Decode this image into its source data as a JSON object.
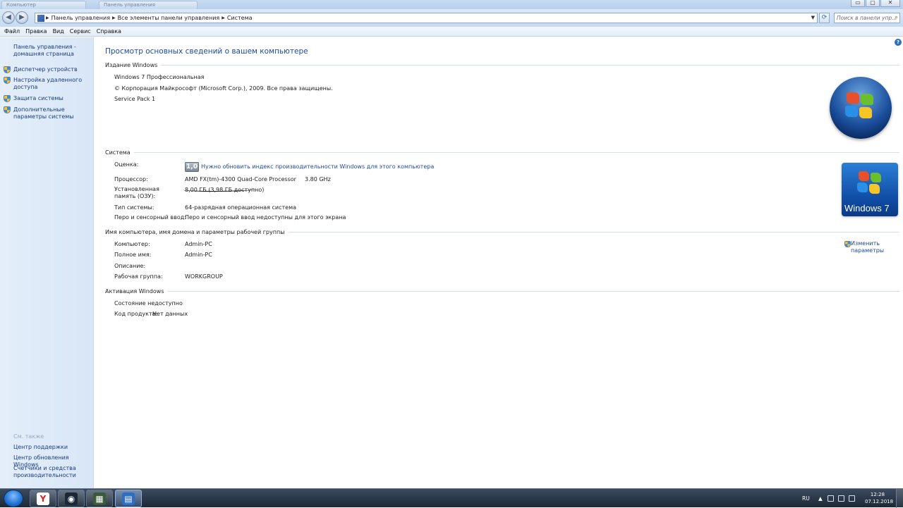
{
  "titlebar": {
    "ghost_tabs": [
      "Компьютер",
      "Панель управления"
    ]
  },
  "window_controls": {
    "minimize": "▭",
    "maximize": "▢",
    "close": "✕"
  },
  "navigation": {
    "back_glyph": "◀",
    "forward_glyph": "▶",
    "breadcrumb": [
      "Панель управления",
      "Все элементы панели управления",
      "Система"
    ],
    "refresh_glyph": "⟳",
    "search_placeholder": "Поиск в панели упр..."
  },
  "menu": [
    "Файл",
    "Правка",
    "Вид",
    "Сервис",
    "Справка"
  ],
  "sidebar": {
    "home_link": "Панель управления - домашняя страница",
    "tasks": [
      "Диспетчер устройств",
      "Настройка удаленного доступа",
      "Защита системы",
      "Дополнительные параметры системы"
    ],
    "see_also_header": "См. также",
    "see_also": [
      "Центр поддержки",
      "Центр обновления Windows",
      "Счетчики и средства производительности"
    ]
  },
  "main": {
    "title": "Просмотр основных сведений о вашем компьютере",
    "edition": {
      "header": "Издание Windows",
      "name": "Windows 7 Профессиональная",
      "copyright": "© Корпорация Майкрософт (Microsoft Corp.), 2009. Все права защищены.",
      "service_pack": "Service Pack 1"
    },
    "system": {
      "header": "Система",
      "rating_label": "Оценка:",
      "rating_badge": "1,0",
      "rating_link": "Нужно обновить индекс производительности Windows для этого компьютера",
      "cpu_label": "Процессор:",
      "cpu_value": "AMD FX(tm)-4300 Quad-Core Processor",
      "cpu_speed": "3.80 GHz",
      "ram_label": "Установленная память (ОЗУ):",
      "ram_value": "8,00 ГБ (3,98 ГБ доступно)",
      "type_label": "Тип системы:",
      "type_value": "64-разрядная операционная система",
      "pen_label": "Перо и сенсорный ввод:",
      "pen_value": "Перо и сенсорный ввод недоступны для этого экрана"
    },
    "computer": {
      "header": "Имя компьютера, имя домена и параметры рабочей группы",
      "computer_label": "Компьютер:",
      "computer_value": "Admin-PC",
      "fullname_label": "Полное имя:",
      "fullname_value": "Admin-PC",
      "description_label": "Описание:",
      "description_value": "",
      "workgroup_label": "Рабочая группа:",
      "workgroup_value": "WORKGROUP",
      "change_link": "Изменить параметры"
    },
    "activation": {
      "header": "Активация Windows",
      "status": "Состояние недоступно",
      "product_key_label": "Код продукта:",
      "product_key_value": "Нет данных"
    },
    "logo_text": "Windows 7"
  },
  "taskbar": {
    "buttons": [
      {
        "icon": "yandex-browser-icon",
        "glyph": "Y",
        "color": "#e02020"
      },
      {
        "icon": "steam-icon",
        "glyph": "◉",
        "color": "#1b2838"
      },
      {
        "icon": "game-icon",
        "glyph": "▦",
        "color": "#3a5a3a"
      },
      {
        "icon": "control-panel-icon",
        "glyph": "▤",
        "color": "#2a6fc4"
      }
    ],
    "language": "RU",
    "time": "12:28",
    "date": "07.12.2018"
  },
  "colors": {
    "link": "#1e4aa0",
    "sidebar_bg": "#dfeaf8",
    "taskbar_bg": "#2a3748"
  }
}
